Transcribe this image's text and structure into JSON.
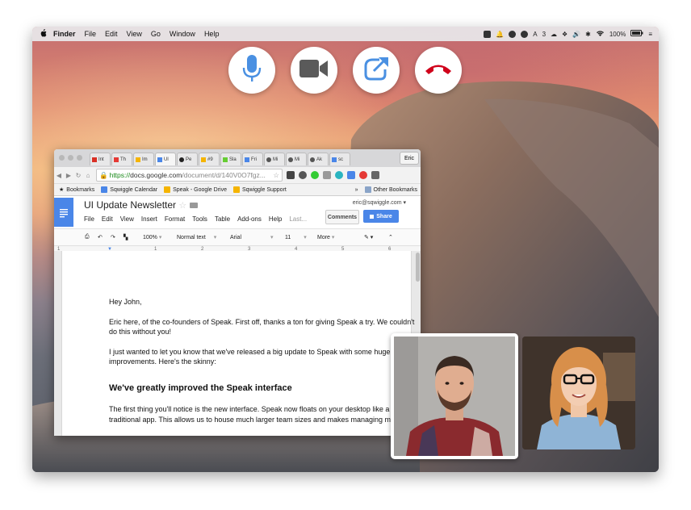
{
  "menubar": {
    "apple": "",
    "items": [
      "Finder",
      "File",
      "Edit",
      "View",
      "Go",
      "Window",
      "Help"
    ],
    "status_number": "3",
    "battery": "100%"
  },
  "call_controls": {
    "mic_icon": "microphone-icon",
    "camera_icon": "video-camera-icon",
    "share_icon": "share-screen-icon",
    "hangup_icon": "hang-up-phone-icon",
    "hangup_color": "#d0021b",
    "accent_color": "#4a90e2"
  },
  "browser": {
    "tabs": [
      "Int",
      "Th",
      "Im",
      "Ul",
      "Pe",
      "#9",
      "Sla",
      "Fri",
      "Mi",
      "Mi",
      "Ak",
      "sc"
    ],
    "user_label": "Eric",
    "url_secure": "https://",
    "url_host": "docs.google.com",
    "url_rest": "/document/d/140V0O7fgz...",
    "bookmarks": [
      {
        "label": "Bookmarks",
        "icon": "star-icon"
      },
      {
        "label": "Sqwiggle Calendar",
        "icon": "calendar-icon"
      },
      {
        "label": "Speak - Google Drive",
        "icon": "drive-icon"
      },
      {
        "label": "Sqwiggle Support",
        "icon": "sqwiggle-icon"
      }
    ],
    "bookmarks_more": "»",
    "other_bookmarks": "Other Bookmarks"
  },
  "docs": {
    "title": "UI Update Newsletter",
    "email": "eric@sqwiggle.com",
    "menu": [
      "File",
      "Edit",
      "View",
      "Insert",
      "Format",
      "Tools",
      "Table",
      "Add-ons",
      "Help"
    ],
    "last_edit": "Last...",
    "comments_button": "Comments",
    "share_button": "Share",
    "zoom": "100%",
    "style": "Normal text",
    "font": "Arial",
    "size": "11",
    "more": "More",
    "ruler_marks": [
      "1",
      "1",
      "2",
      "3",
      "4",
      "5",
      "6"
    ]
  },
  "document": {
    "greeting": "Hey John,",
    "p1": "Eric here, of the co-founders of Speak. First off, thanks a ton for giving Speak a try. We couldn't do this without you!",
    "p2": "I just wanted to let you know that we've released a big update to Speak with some huge improvements. Here's the skinny:",
    "heading": "We've greatly improved the Speak interface",
    "p3": "The first thing you'll notice is the new interface. Speak now floats on your desktop like a traditional app. This allows us to house much larger team sizes  and makes managing m"
  },
  "videos": [
    {
      "name": "participant-1",
      "icon": "person-video-feed"
    },
    {
      "name": "participant-2",
      "icon": "person-video-feed"
    }
  ]
}
